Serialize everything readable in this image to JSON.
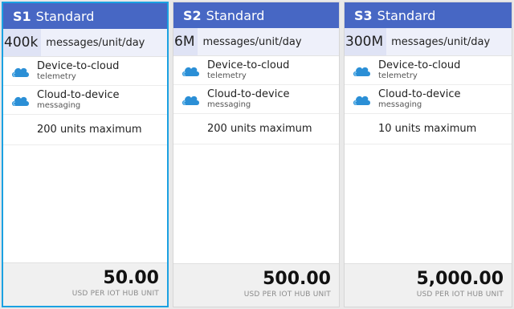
{
  "colors": {
    "header": "#4767c4",
    "selected_border": "#1ba1e2",
    "icon": "#2b8fd6"
  },
  "cards": [
    {
      "tier": "S1",
      "level": "Standard",
      "rate_value": "400k",
      "rate_unit": "messages/unit/day",
      "feature1_main": "Device-to-cloud",
      "feature1_sub": "telemetry",
      "feature2_main": "Cloud-to-device",
      "feature2_sub": "messaging",
      "max_units": "200 units maximum",
      "price": "50.00",
      "price_unit": "USD PER IOT HUB UNIT",
      "selected": true,
      "icon": "cloud-icon"
    },
    {
      "tier": "S2",
      "level": "Standard",
      "rate_value": "6M",
      "rate_unit": "messages/unit/day",
      "feature1_main": "Device-to-cloud",
      "feature1_sub": "telemetry",
      "feature2_main": "Cloud-to-device",
      "feature2_sub": "messaging",
      "max_units": "200 units maximum",
      "price": "500.00",
      "price_unit": "USD PER IOT HUB UNIT",
      "selected": false,
      "icon": "cloud-icon"
    },
    {
      "tier": "S3",
      "level": "Standard",
      "rate_value": "300M",
      "rate_unit": "messages/unit/day",
      "feature1_main": "Device-to-cloud",
      "feature1_sub": "telemetry",
      "feature2_main": "Cloud-to-device",
      "feature2_sub": "messaging",
      "max_units": "10 units maximum",
      "price": "5,000.00",
      "price_unit": "USD PER IOT HUB UNIT",
      "selected": false,
      "icon": "cloud-icon"
    }
  ]
}
